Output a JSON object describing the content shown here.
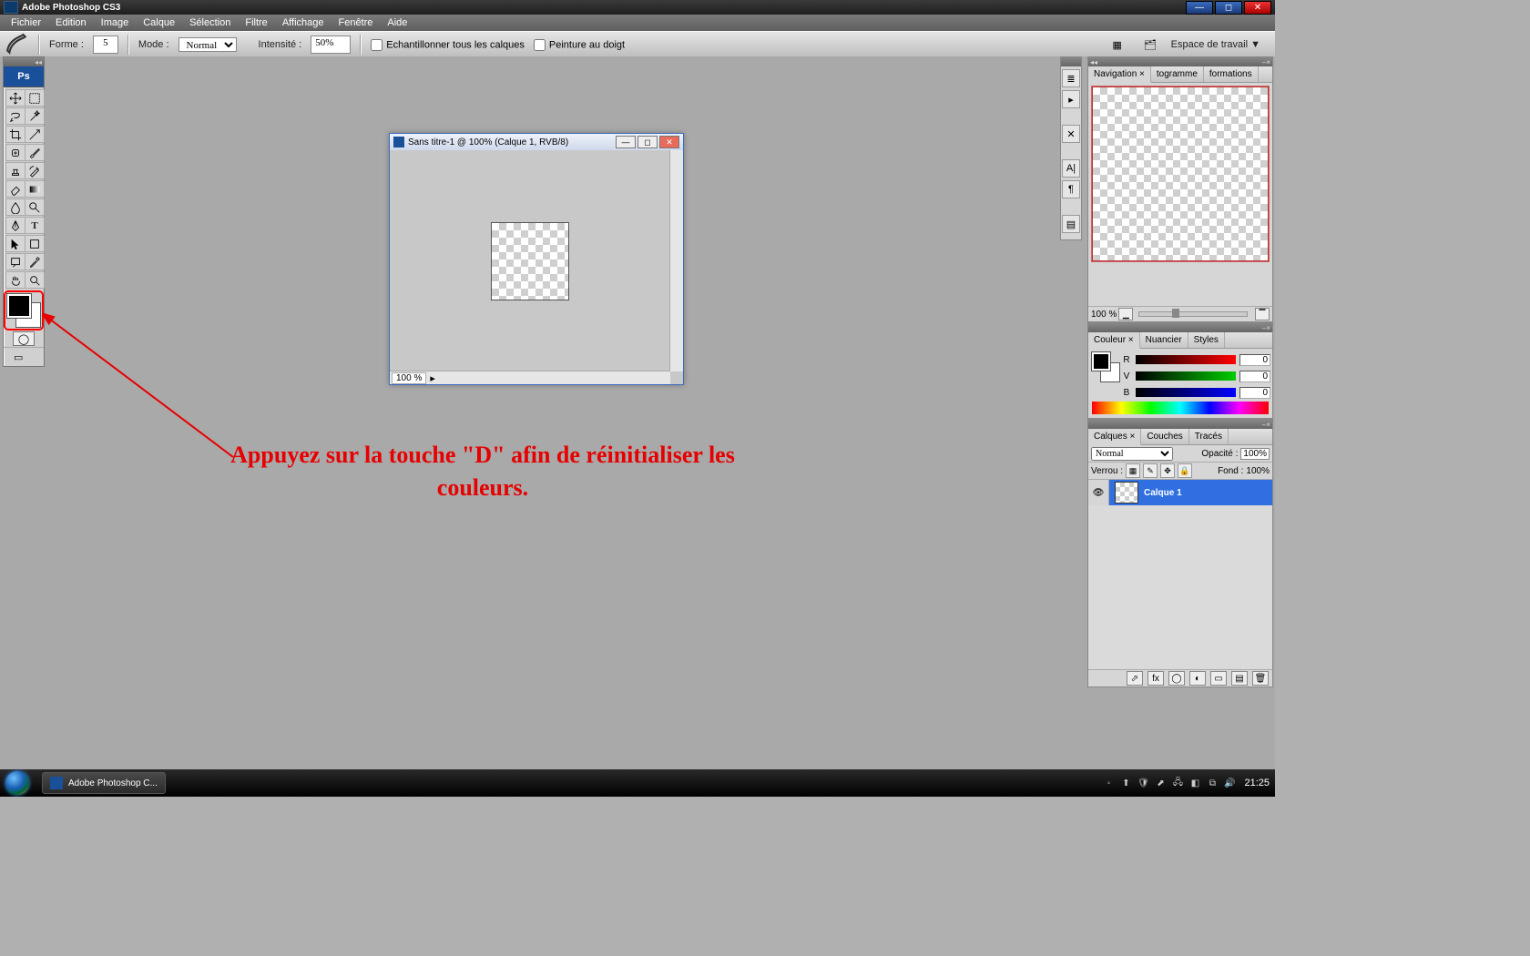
{
  "os_title": "Adobe Photoshop CS3",
  "menubar": [
    "Fichier",
    "Edition",
    "Image",
    "Calque",
    "Sélection",
    "Filtre",
    "Affichage",
    "Fenêtre",
    "Aide"
  ],
  "options": {
    "forme_label": "Forme :",
    "forme_value": "5",
    "mode_label": "Mode :",
    "mode_value": "Normal",
    "intensite_label": "Intensité :",
    "intensite_value": "50%",
    "sample_all_label": "Echantillonner tous les calques",
    "finger_paint_label": "Peinture au doigt",
    "workspace_label": "Espace de travail ▼"
  },
  "document": {
    "title": "Sans titre-1 @ 100% (Calque 1, RVB/8)",
    "zoom": "100 %"
  },
  "annotation": "Appuyez sur la touche \"D\" afin de réinitialiser les couleurs.",
  "panels": {
    "nav": {
      "tabs": [
        "Navigation ×",
        "togramme",
        "formations"
      ],
      "zoom": "100 %"
    },
    "color": {
      "tabs": [
        "Couleur ×",
        "Nuancier",
        "Styles"
      ],
      "channels": [
        {
          "label": "R",
          "value": "0"
        },
        {
          "label": "V",
          "value": "0"
        },
        {
          "label": "B",
          "value": "0"
        }
      ]
    },
    "layers": {
      "tabs": [
        "Calques ×",
        "Couches",
        "Tracés"
      ],
      "blend": "Normal",
      "opacity_label": "Opacité :",
      "opacity": "100%",
      "lock_label": "Verrou :",
      "fill_label": "Fond :",
      "fill": "100%",
      "layer_name": "Calque 1"
    }
  },
  "taskbar": {
    "app": "Adobe Photoshop C...",
    "clock": "21:25"
  }
}
